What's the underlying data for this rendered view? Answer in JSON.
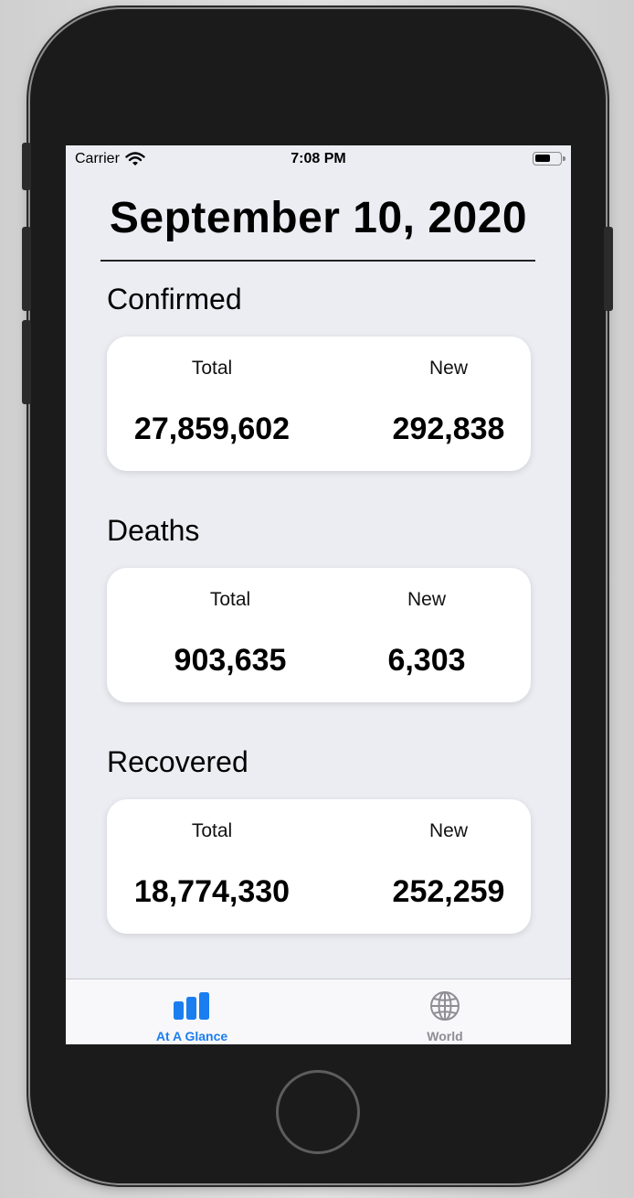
{
  "status_bar": {
    "carrier": "Carrier",
    "time": "7:08 PM"
  },
  "header": {
    "date": "September 10, 2020"
  },
  "sections": [
    {
      "title": "Confirmed",
      "total_label": "Total",
      "new_label": "New",
      "total": "27,859,602",
      "new": "292,838"
    },
    {
      "title": "Deaths",
      "total_label": "Total",
      "new_label": "New",
      "total": "903,635",
      "new": "6,303"
    },
    {
      "title": "Recovered",
      "total_label": "Total",
      "new_label": "New",
      "total": "18,774,330",
      "new": "252,259"
    }
  ],
  "tabs": [
    {
      "label": "At A Glance",
      "icon": "bar-chart-icon",
      "active": true
    },
    {
      "label": "World",
      "icon": "globe-icon",
      "active": false
    }
  ],
  "colors": {
    "accent": "#1b7ef0",
    "inactive": "#8e8e93",
    "screen_bg": "#ecedf3",
    "card_bg": "#ffffff"
  }
}
